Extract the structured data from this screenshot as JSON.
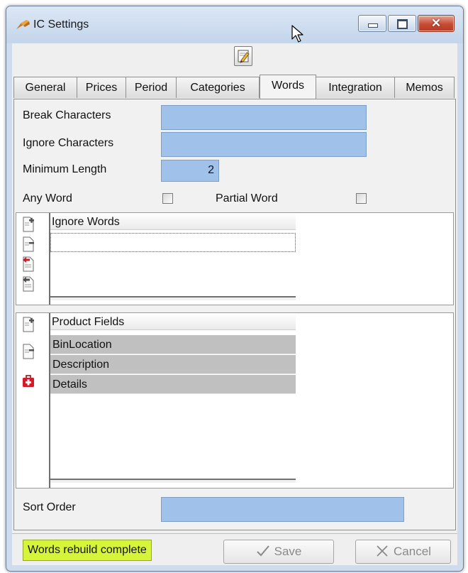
{
  "window": {
    "title": "IC Settings",
    "controls": {
      "minimize": "minimize",
      "maximize": "maximize",
      "close": "✕"
    }
  },
  "toolbar": {
    "edit_icon": "edit-icon"
  },
  "tabs": [
    {
      "label": "General"
    },
    {
      "label": "Prices"
    },
    {
      "label": "Period"
    },
    {
      "label": "Categories"
    },
    {
      "label": "Words",
      "active": true
    },
    {
      "label": "Integration"
    },
    {
      "label": "Memos"
    }
  ],
  "words": {
    "break_characters": {
      "label": "Break Characters",
      "value": ""
    },
    "ignore_characters": {
      "label": "Ignore Characters",
      "value": ""
    },
    "minimum_length": {
      "label": "Minimum Length",
      "value": "2"
    },
    "any_word": {
      "label": "Any Word",
      "checked": false
    },
    "partial_word": {
      "label": "Partial Word",
      "checked": false
    },
    "ignore_words": {
      "header": "Ignore Words",
      "rows": []
    },
    "product_fields": {
      "header": "Product Fields",
      "rows": [
        "BinLocation",
        "Description",
        "Details"
      ]
    },
    "sort_order": {
      "label": "Sort Order",
      "value": ""
    }
  },
  "status": {
    "message": "Words rebuild complete"
  },
  "buttons": {
    "save": "Save",
    "cancel": "Cancel"
  },
  "colors": {
    "field": "#9fc1ea",
    "toast": "#d6f53a",
    "row": "#c0c0c0",
    "close": "#c64b34"
  }
}
